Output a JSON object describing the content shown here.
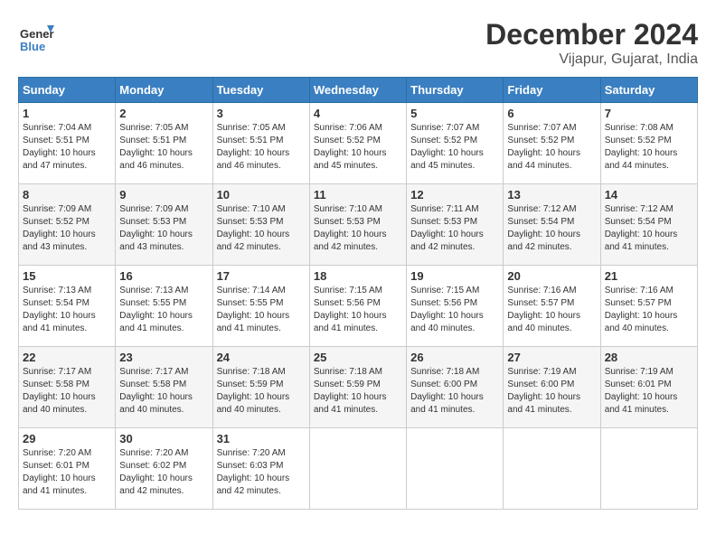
{
  "header": {
    "logo_line1": "General",
    "logo_line2": "Blue",
    "month": "December 2024",
    "location": "Vijapur, Gujarat, India"
  },
  "weekdays": [
    "Sunday",
    "Monday",
    "Tuesday",
    "Wednesday",
    "Thursday",
    "Friday",
    "Saturday"
  ],
  "weeks": [
    [
      {
        "day": "1",
        "info": "Sunrise: 7:04 AM\nSunset: 5:51 PM\nDaylight: 10 hours\nand 47 minutes."
      },
      {
        "day": "2",
        "info": "Sunrise: 7:05 AM\nSunset: 5:51 PM\nDaylight: 10 hours\nand 46 minutes."
      },
      {
        "day": "3",
        "info": "Sunrise: 7:05 AM\nSunset: 5:51 PM\nDaylight: 10 hours\nand 46 minutes."
      },
      {
        "day": "4",
        "info": "Sunrise: 7:06 AM\nSunset: 5:52 PM\nDaylight: 10 hours\nand 45 minutes."
      },
      {
        "day": "5",
        "info": "Sunrise: 7:07 AM\nSunset: 5:52 PM\nDaylight: 10 hours\nand 45 minutes."
      },
      {
        "day": "6",
        "info": "Sunrise: 7:07 AM\nSunset: 5:52 PM\nDaylight: 10 hours\nand 44 minutes."
      },
      {
        "day": "7",
        "info": "Sunrise: 7:08 AM\nSunset: 5:52 PM\nDaylight: 10 hours\nand 44 minutes."
      }
    ],
    [
      {
        "day": "8",
        "info": "Sunrise: 7:09 AM\nSunset: 5:52 PM\nDaylight: 10 hours\nand 43 minutes."
      },
      {
        "day": "9",
        "info": "Sunrise: 7:09 AM\nSunset: 5:53 PM\nDaylight: 10 hours\nand 43 minutes."
      },
      {
        "day": "10",
        "info": "Sunrise: 7:10 AM\nSunset: 5:53 PM\nDaylight: 10 hours\nand 42 minutes."
      },
      {
        "day": "11",
        "info": "Sunrise: 7:10 AM\nSunset: 5:53 PM\nDaylight: 10 hours\nand 42 minutes."
      },
      {
        "day": "12",
        "info": "Sunrise: 7:11 AM\nSunset: 5:53 PM\nDaylight: 10 hours\nand 42 minutes."
      },
      {
        "day": "13",
        "info": "Sunrise: 7:12 AM\nSunset: 5:54 PM\nDaylight: 10 hours\nand 42 minutes."
      },
      {
        "day": "14",
        "info": "Sunrise: 7:12 AM\nSunset: 5:54 PM\nDaylight: 10 hours\nand 41 minutes."
      }
    ],
    [
      {
        "day": "15",
        "info": "Sunrise: 7:13 AM\nSunset: 5:54 PM\nDaylight: 10 hours\nand 41 minutes."
      },
      {
        "day": "16",
        "info": "Sunrise: 7:13 AM\nSunset: 5:55 PM\nDaylight: 10 hours\nand 41 minutes."
      },
      {
        "day": "17",
        "info": "Sunrise: 7:14 AM\nSunset: 5:55 PM\nDaylight: 10 hours\nand 41 minutes."
      },
      {
        "day": "18",
        "info": "Sunrise: 7:15 AM\nSunset: 5:56 PM\nDaylight: 10 hours\nand 41 minutes."
      },
      {
        "day": "19",
        "info": "Sunrise: 7:15 AM\nSunset: 5:56 PM\nDaylight: 10 hours\nand 40 minutes."
      },
      {
        "day": "20",
        "info": "Sunrise: 7:16 AM\nSunset: 5:57 PM\nDaylight: 10 hours\nand 40 minutes."
      },
      {
        "day": "21",
        "info": "Sunrise: 7:16 AM\nSunset: 5:57 PM\nDaylight: 10 hours\nand 40 minutes."
      }
    ],
    [
      {
        "day": "22",
        "info": "Sunrise: 7:17 AM\nSunset: 5:58 PM\nDaylight: 10 hours\nand 40 minutes."
      },
      {
        "day": "23",
        "info": "Sunrise: 7:17 AM\nSunset: 5:58 PM\nDaylight: 10 hours\nand 40 minutes."
      },
      {
        "day": "24",
        "info": "Sunrise: 7:18 AM\nSunset: 5:59 PM\nDaylight: 10 hours\nand 40 minutes."
      },
      {
        "day": "25",
        "info": "Sunrise: 7:18 AM\nSunset: 5:59 PM\nDaylight: 10 hours\nand 41 minutes."
      },
      {
        "day": "26",
        "info": "Sunrise: 7:18 AM\nSunset: 6:00 PM\nDaylight: 10 hours\nand 41 minutes."
      },
      {
        "day": "27",
        "info": "Sunrise: 7:19 AM\nSunset: 6:00 PM\nDaylight: 10 hours\nand 41 minutes."
      },
      {
        "day": "28",
        "info": "Sunrise: 7:19 AM\nSunset: 6:01 PM\nDaylight: 10 hours\nand 41 minutes."
      }
    ],
    [
      {
        "day": "29",
        "info": "Sunrise: 7:20 AM\nSunset: 6:01 PM\nDaylight: 10 hours\nand 41 minutes."
      },
      {
        "day": "30",
        "info": "Sunrise: 7:20 AM\nSunset: 6:02 PM\nDaylight: 10 hours\nand 42 minutes."
      },
      {
        "day": "31",
        "info": "Sunrise: 7:20 AM\nSunset: 6:03 PM\nDaylight: 10 hours\nand 42 minutes."
      },
      null,
      null,
      null,
      null
    ]
  ]
}
